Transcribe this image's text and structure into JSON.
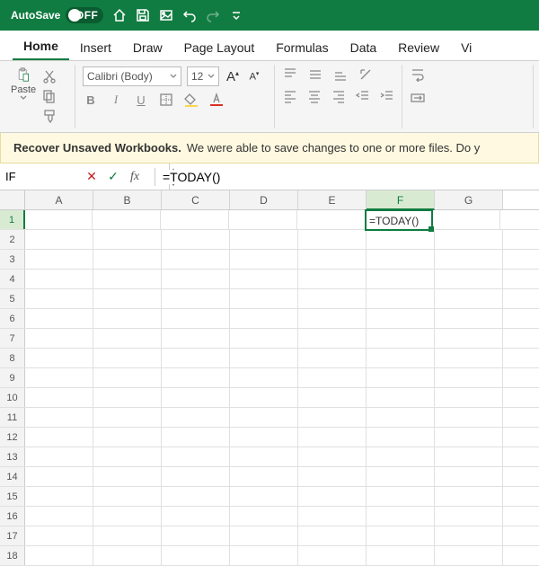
{
  "titlebar": {
    "autosave_label": "AutoSave",
    "autosave_state": "OFF"
  },
  "tabs": [
    "Home",
    "Insert",
    "Draw",
    "Page Layout",
    "Formulas",
    "Data",
    "Review",
    "Vi"
  ],
  "active_tab": "Home",
  "ribbon": {
    "paste_label": "Paste",
    "font_name": "Calibri (Body)",
    "font_size": "12",
    "bold": "B",
    "italic": "I",
    "underline": "U"
  },
  "banner": {
    "title": "Recover Unsaved Workbooks.",
    "msg": "We were able to save changes to one or more files. Do y"
  },
  "namebox": "IF",
  "formula": "=TODAY()",
  "columns": [
    "A",
    "B",
    "C",
    "D",
    "E",
    "F",
    "G"
  ],
  "rows": [
    "1",
    "2",
    "3",
    "4",
    "5",
    "6",
    "7",
    "8",
    "9",
    "10",
    "11",
    "12",
    "13",
    "14",
    "15",
    "16",
    "17",
    "18"
  ],
  "active_cell": {
    "col": "F",
    "row": "1",
    "value": "=TODAY()"
  }
}
